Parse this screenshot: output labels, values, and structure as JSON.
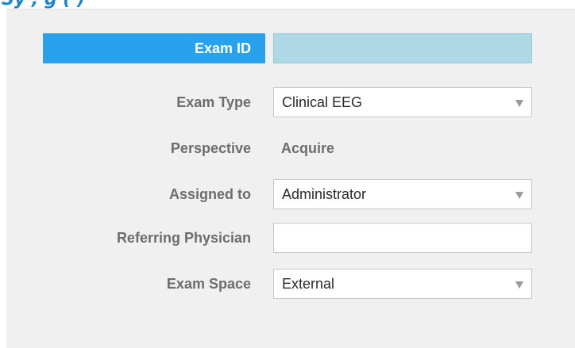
{
  "heading": "Sy                          , g    (                    )",
  "form": {
    "exam_id": {
      "label": "Exam ID",
      "value": ""
    },
    "exam_type": {
      "label": "Exam Type",
      "value": "Clinical EEG",
      "icon": "chevron-down-icon"
    },
    "perspective": {
      "label": "Perspective",
      "value": "Acquire"
    },
    "assigned_to": {
      "label": "Assigned to",
      "value": "Administrator",
      "icon": "chevron-down-icon"
    },
    "referring_physician": {
      "label": "Referring Physician",
      "value": ""
    },
    "exam_space": {
      "label": "Exam Space",
      "value": "External",
      "icon": "chevron-down-icon"
    }
  },
  "colors": {
    "panel_bg": "#f0f0f0",
    "selected_label_bg": "#2aa1ec",
    "active_field_bg": "#add8e6",
    "label_text": "#6d6d6d"
  }
}
